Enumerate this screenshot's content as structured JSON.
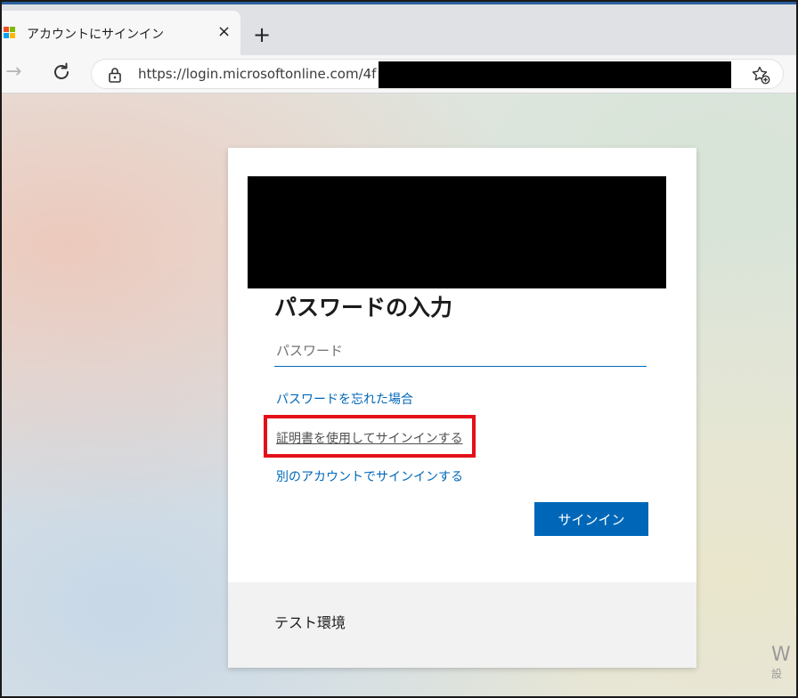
{
  "browser": {
    "tab_title": "アカウントにサインイン",
    "tab_close_glyph": "×",
    "new_tab_glyph": "+",
    "back_glyph": "→",
    "url": "https://login.microsoftonline.com/4f"
  },
  "signin": {
    "heading": "パスワードの入力",
    "password_placeholder": "パスワード",
    "forgot_password": "パスワードを忘れた場合",
    "use_certificate": "証明書を使用してサインインする",
    "other_account": "別のアカウントでサインインする",
    "signin_button": "サインイン",
    "footer_text": "テスト環境"
  },
  "watermark": {
    "line1": "W",
    "line2": "設"
  },
  "colors": {
    "primary_blue": "#0067b8",
    "highlight_red": "#e3101a",
    "ms_logo": [
      "#f25022",
      "#7fba00",
      "#00a4ef",
      "#ffb900"
    ]
  }
}
